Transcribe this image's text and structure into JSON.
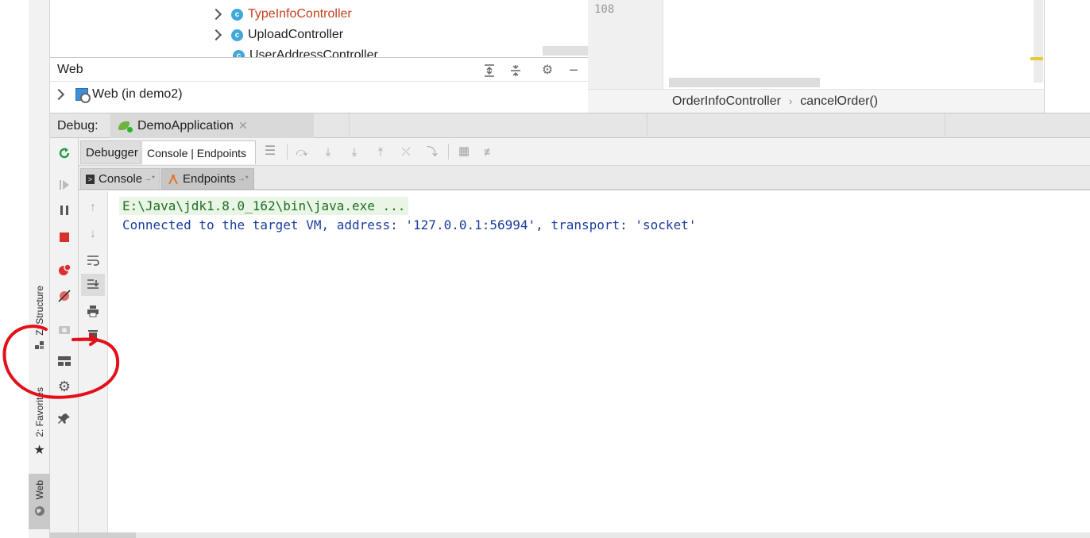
{
  "project_tree": {
    "items": [
      {
        "label": "TypeInfoController",
        "color": "#c0431f"
      },
      {
        "label": "UploadController",
        "color": "#1e1e1e"
      },
      {
        "label": "UserAddressController",
        "color": "#1e1e1e"
      }
    ],
    "class_icon_letter": "c"
  },
  "web_panel": {
    "title": "Web",
    "row_label": "Web (in demo2)",
    "header_icons": [
      "expand-all-icon",
      "collapse-all-icon",
      "gear-icon",
      "minimize-icon"
    ]
  },
  "editor": {
    "line_number": "108",
    "breadcrumbs": [
      "OrderInfoController",
      "cancelOrder()"
    ]
  },
  "debug": {
    "label": "Debug:",
    "run_tab": "DemoApplication",
    "subtabs": {
      "debugger": "Debugger",
      "console_endpoints": "Console | Endpoints"
    },
    "inner_tabs": {
      "console": "Console",
      "endpoints": "Endpoints"
    }
  },
  "left_stripe": {
    "structure": "Z: Structure",
    "favorites": "2: Favorites",
    "web": "Web"
  },
  "console": {
    "lines": [
      "E:\\Java\\jdk1.8.0_162\\bin\\java.exe ...",
      "Connected to the target VM, address: '127.0.0.1:56994', transport: 'socket'"
    ]
  },
  "colors": {
    "accent_run": "#1f9c44",
    "stop_red": "#d9302c",
    "annotation_red": "#e3101a",
    "console_blue": "#1a3c9e",
    "console_green": "#1f6d28"
  }
}
